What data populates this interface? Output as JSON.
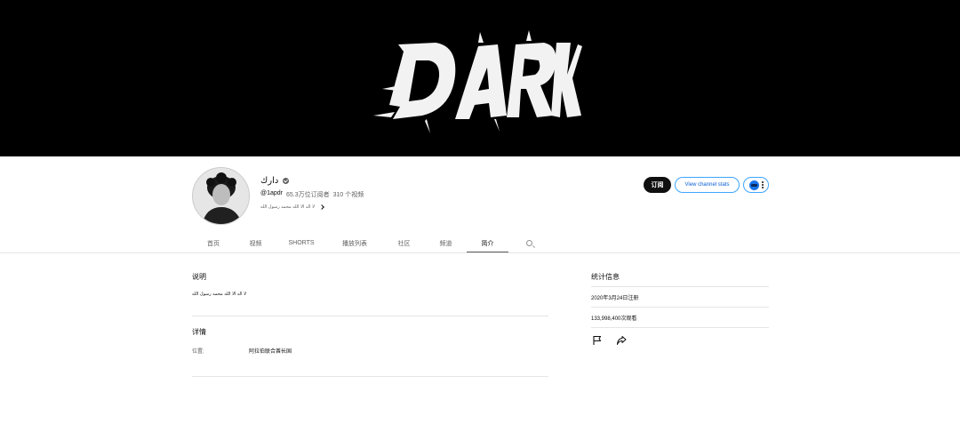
{
  "banner": {
    "logo_text": "DARK"
  },
  "channel": {
    "name": "دارك",
    "handle": "@1apdr",
    "subscribers": "65.3万位订阅者",
    "videos": "310 个视频",
    "tagline": "لا اله الا الله محمد رسول الله"
  },
  "actions": {
    "subscribe_label": "订阅",
    "stats_label": "View channel stats"
  },
  "tabs": [
    {
      "label": "首页"
    },
    {
      "label": "视频"
    },
    {
      "label": "SHORTS"
    },
    {
      "label": "播放列表"
    },
    {
      "label": "社区"
    },
    {
      "label": "频道"
    },
    {
      "label": "简介"
    }
  ],
  "about": {
    "description_title": "说明",
    "description_text": "لا اله الا الله محمد رسول الله",
    "details_title": "详情",
    "location_label": "位置:",
    "location_value": "阿拉伯联合酋长国"
  },
  "stats": {
    "title": "统计信息",
    "joined": "2020年3月24日注册",
    "views": "133,998,400次观看"
  },
  "colors": {
    "banner_bg": "#000000",
    "subscribe_bg": "#0f0f0f",
    "accent_blue": "#3ea6ff",
    "link_blue": "#065fd4"
  }
}
